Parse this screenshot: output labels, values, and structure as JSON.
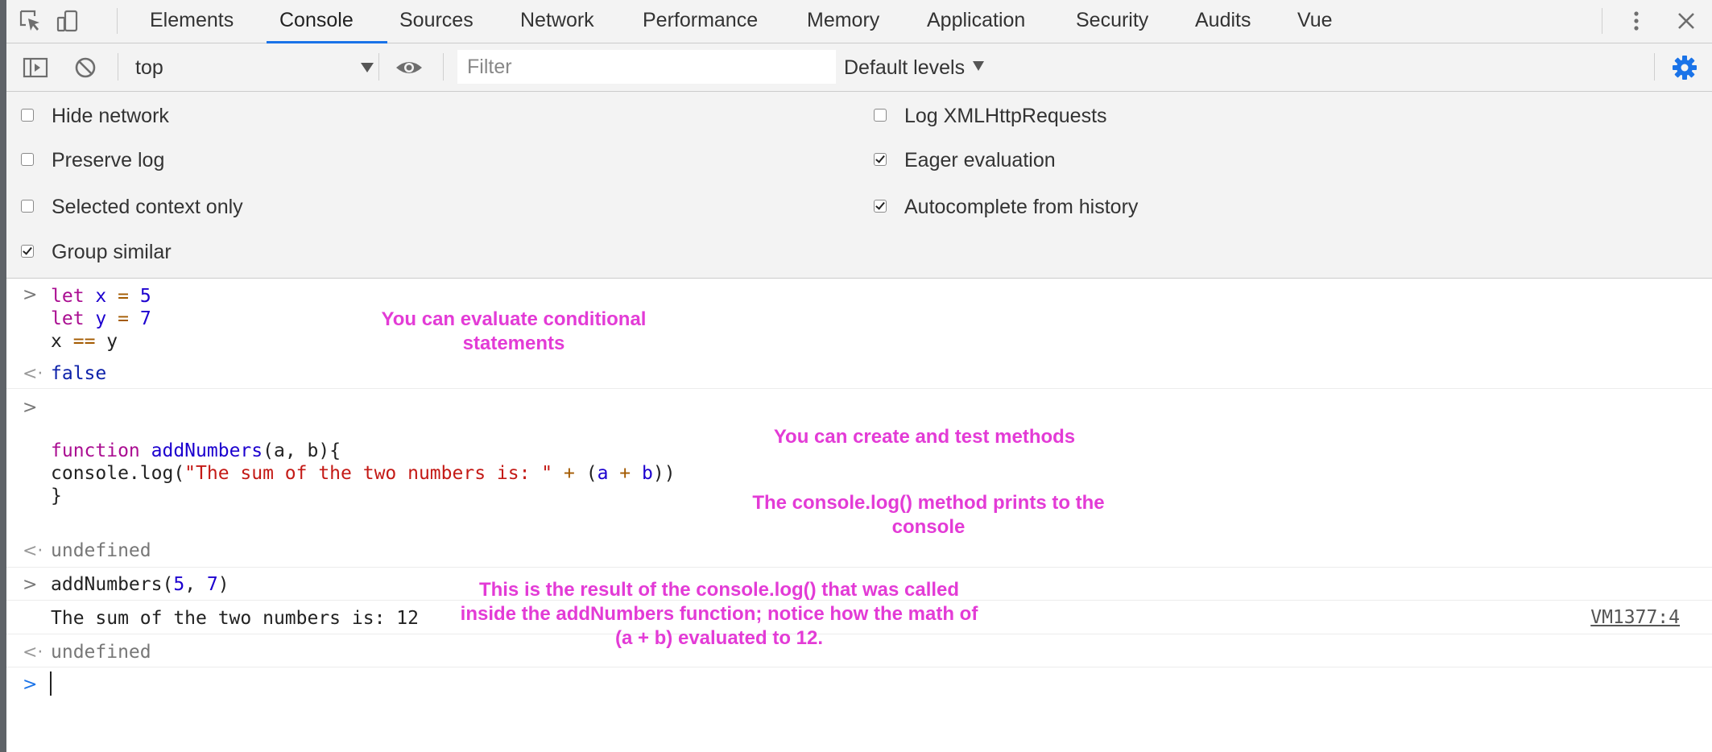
{
  "tabs": [
    "Elements",
    "Console",
    "Sources",
    "Network",
    "Performance",
    "Memory",
    "Application",
    "Security",
    "Audits",
    "Vue"
  ],
  "active_tab": "Console",
  "toolbar": {
    "context": "top",
    "filter_placeholder": "Filter",
    "levels": "Default levels"
  },
  "settings": {
    "left": [
      {
        "label": "Hide network",
        "checked": false
      },
      {
        "label": "Preserve log",
        "checked": false
      },
      {
        "label": "Selected context only",
        "checked": false
      },
      {
        "label": "Group similar",
        "checked": true
      }
    ],
    "right": [
      {
        "label": "Log XMLHttpRequests",
        "checked": false
      },
      {
        "label": "Eager evaluation",
        "checked": true
      },
      {
        "label": "Autocomplete from history",
        "checked": true
      }
    ]
  },
  "console": {
    "input1": {
      "l1": {
        "kw": "let",
        "var": "x",
        "op": "=",
        "num": "5"
      },
      "l2": {
        "kw": "let",
        "var": "y",
        "op": "=",
        "num": "7"
      },
      "l3": {
        "a": "x",
        "op": "==",
        "b": "y"
      }
    },
    "result1": "false",
    "input2": {
      "kw": "function",
      "name": "addNumbers",
      "params": "(a, b){",
      "body_prefix": "console.log(",
      "string": "\"The sum of the two numbers is: \"",
      "plus": "+",
      "expr_open": "(",
      "a": "a",
      "b": "b",
      "expr_close": "))",
      "close": "}"
    },
    "result2": "undefined",
    "input3": {
      "call": "addNumbers(",
      "n1": "5",
      "sep": ",",
      "n2": "7",
      "close": ")"
    },
    "log_output": "The sum of the two numbers is: 12",
    "log_source": "VM1377:4",
    "result3": "undefined"
  },
  "annotations": {
    "conditional": "You can evaluate conditional statements",
    "methods": "You can create and test methods",
    "console_log": "The console.log() method prints to the console",
    "result": "This is the result of the console.log() that was called inside the addNumbers function; notice how the math of (a + b) evaluated to 12."
  },
  "colors": {
    "annotation": "#e33bd6",
    "accent": "#1a73e8",
    "keyword": "#aa0d91",
    "string": "#c41a16"
  },
  "icons": [
    "inspect-element-icon",
    "device-toggle-icon",
    "more-vert-icon",
    "close-icon",
    "sidebar-toggle-icon",
    "clear-console-icon",
    "eye-icon",
    "settings-gear-icon"
  ]
}
